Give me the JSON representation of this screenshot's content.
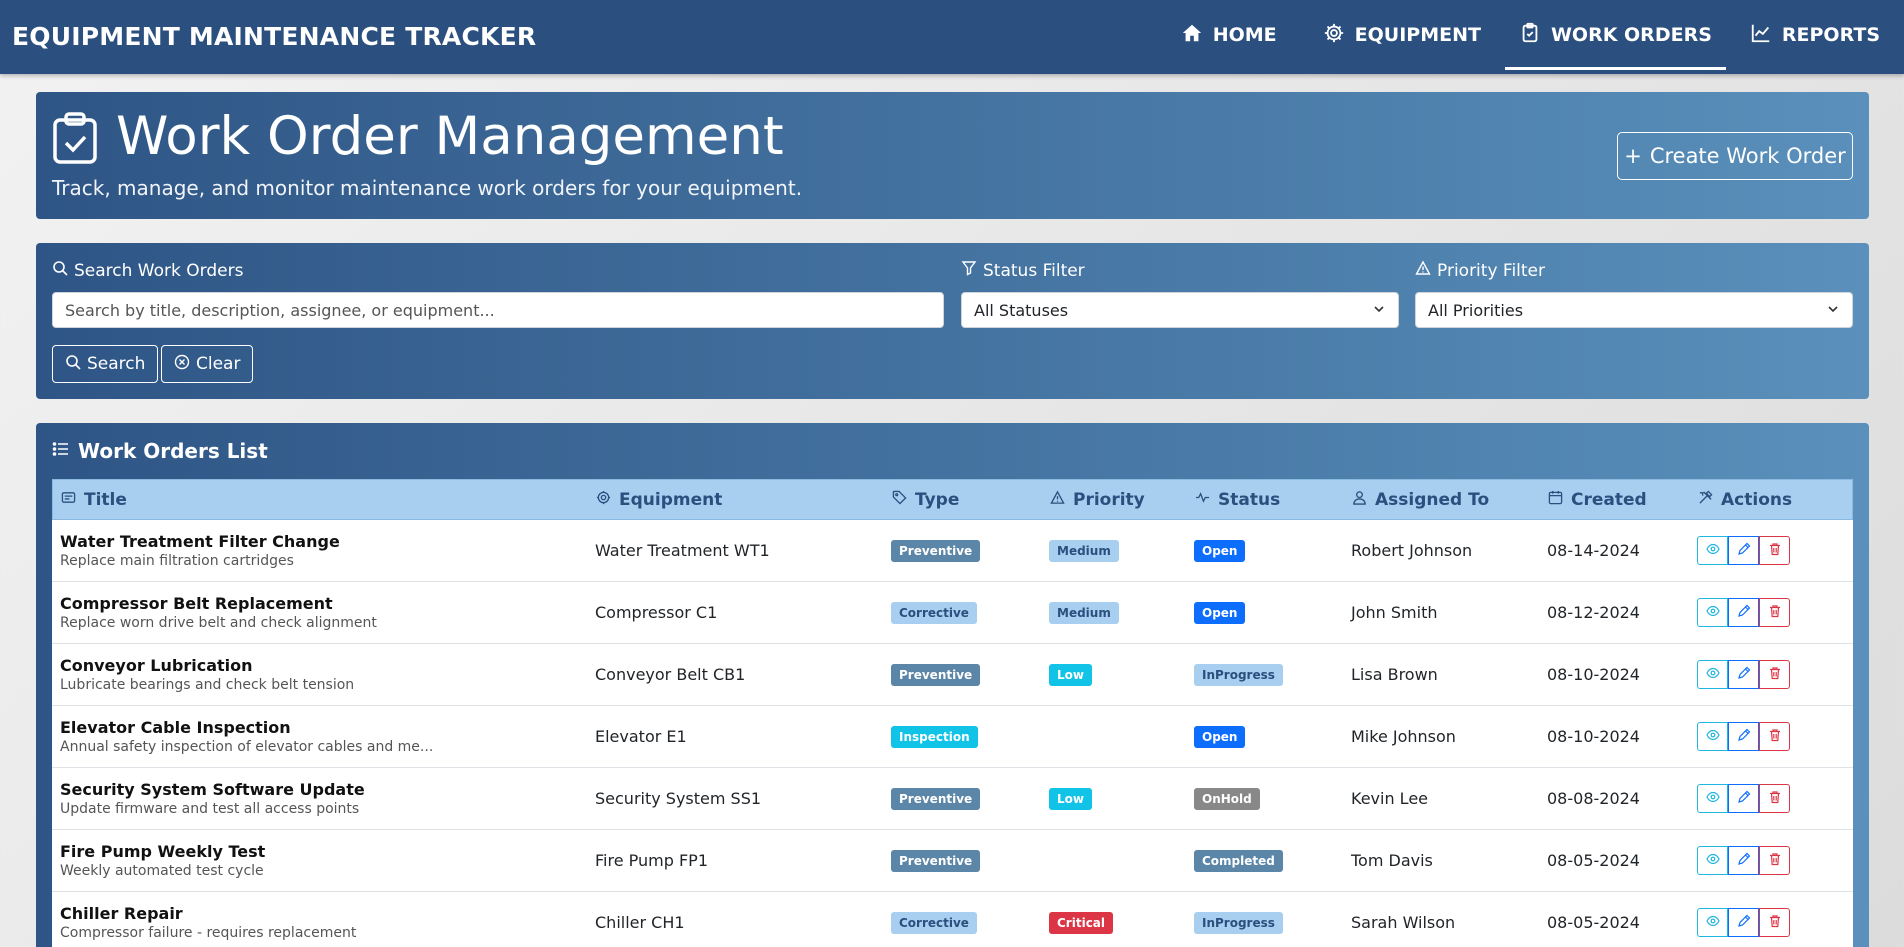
{
  "navbar": {
    "brand": "EQUIPMENT MAINTENANCE TRACKER",
    "items": [
      {
        "label": "HOME",
        "icon": "home-icon",
        "active": false
      },
      {
        "label": "EQUIPMENT",
        "icon": "gear-icon",
        "active": false
      },
      {
        "label": "WORK ORDERS",
        "icon": "clipboard-check-icon",
        "active": true
      },
      {
        "label": "REPORTS",
        "icon": "chart-line-icon",
        "active": false
      }
    ]
  },
  "header": {
    "title": "Work Order Management",
    "subtitle": "Track, manage, and monitor maintenance work orders for your equipment.",
    "create_button": "Create Work Order"
  },
  "filters": {
    "search_label": "Search Work Orders",
    "search_placeholder": "Search by title, description, assignee, or equipment...",
    "status_label": "Status Filter",
    "status_value": "All Statuses",
    "priority_label": "Priority Filter",
    "priority_value": "All Priorities",
    "search_button": "Search",
    "clear_button": "Clear"
  },
  "list": {
    "title": "Work Orders List",
    "columns": [
      "Title",
      "Equipment",
      "Type",
      "Priority",
      "Status",
      "Assigned To",
      "Created",
      "Actions"
    ],
    "rows": [
      {
        "title": "Water Treatment Filter Change",
        "desc": "Replace main filtration cartridges",
        "equipment": "Water Treatment WT1",
        "type": "Preventive",
        "priority": "Medium",
        "status": "Open",
        "assigned": "Robert Johnson",
        "created": "08-14-2024"
      },
      {
        "title": "Compressor Belt Replacement",
        "desc": "Replace worn drive belt and check alignment",
        "equipment": "Compressor C1",
        "type": "Corrective",
        "priority": "Medium",
        "status": "Open",
        "assigned": "John Smith",
        "created": "08-12-2024"
      },
      {
        "title": "Conveyor Lubrication",
        "desc": "Lubricate bearings and check belt tension",
        "equipment": "Conveyor Belt CB1",
        "type": "Preventive",
        "priority": "Low",
        "status": "InProgress",
        "assigned": "Lisa Brown",
        "created": "08-10-2024"
      },
      {
        "title": "Elevator Cable Inspection",
        "desc": "Annual safety inspection of elevator cables and me...",
        "equipment": "Elevator E1",
        "type": "Inspection",
        "priority": "",
        "status": "Open",
        "assigned": "Mike Johnson",
        "created": "08-10-2024"
      },
      {
        "title": "Security System Software Update",
        "desc": "Update firmware and test all access points",
        "equipment": "Security System SS1",
        "type": "Preventive",
        "priority": "Low",
        "status": "OnHold",
        "assigned": "Kevin Lee",
        "created": "08-08-2024"
      },
      {
        "title": "Fire Pump Weekly Test",
        "desc": "Weekly automated test cycle",
        "equipment": "Fire Pump FP1",
        "type": "Preventive",
        "priority": "",
        "status": "Completed",
        "assigned": "Tom Davis",
        "created": "08-05-2024"
      },
      {
        "title": "Chiller Repair",
        "desc": "Compressor failure - requires replacement",
        "equipment": "Chiller CH1",
        "type": "Corrective",
        "priority": "Critical",
        "status": "InProgress",
        "assigned": "Sarah Wilson",
        "created": "08-05-2024"
      }
    ]
  },
  "badge_colors": {
    "type": {
      "Preventive": {
        "bg": "#5b86a8",
        "fg": "#ffffff"
      },
      "Corrective": {
        "bg": "#a8cff0",
        "fg": "#2b4f7e"
      },
      "Inspection": {
        "bg": "#12c3e8",
        "fg": "#ffffff"
      }
    },
    "priority": {
      "Medium": {
        "bg": "#a8cff0",
        "fg": "#2b4f7e"
      },
      "Low": {
        "bg": "#12c3e8",
        "fg": "#ffffff"
      },
      "Critical": {
        "bg": "#dc3545",
        "fg": "#ffffff"
      }
    },
    "status": {
      "Open": {
        "bg": "#0d6efd",
        "fg": "#ffffff"
      },
      "InProgress": {
        "bg": "#a8cff0",
        "fg": "#2b4f7e"
      },
      "OnHold": {
        "bg": "#888888",
        "fg": "#ffffff"
      },
      "Completed": {
        "bg": "#5b86a8",
        "fg": "#ffffff"
      }
    }
  }
}
